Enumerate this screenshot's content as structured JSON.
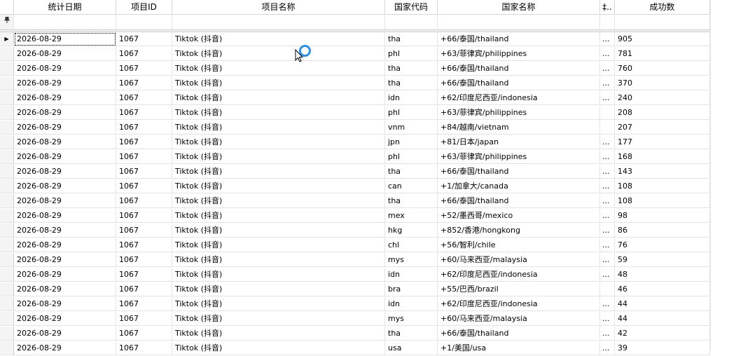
{
  "columns": {
    "date": "统计日期",
    "id": "项目ID",
    "name": "项目名称",
    "code": "国家代码",
    "country": "国家名称",
    "op": "‡..",
    "count": "成功数"
  },
  "filter_icon": "pin-icon",
  "current_row_icon": "row-pointer-icon",
  "rows": [
    {
      "date": "2026-08-29",
      "id": "1067",
      "name": "Tiktok (抖音)",
      "code": "tha",
      "country": "+66/泰国/thailand",
      "op": "...",
      "count": "905"
    },
    {
      "date": "2026-08-29",
      "id": "1067",
      "name": "Tiktok (抖音)",
      "code": "phl",
      "country": "+63/菲律宾/philippines",
      "op": "...",
      "count": "781"
    },
    {
      "date": "2026-08-29",
      "id": "1067",
      "name": "Tiktok (抖音)",
      "code": "tha",
      "country": "+66/泰国/thailand",
      "op": "...",
      "count": "760"
    },
    {
      "date": "2026-08-29",
      "id": "1067",
      "name": "Tiktok (抖音)",
      "code": "tha",
      "country": "+66/泰国/thailand",
      "op": "...",
      "count": "370"
    },
    {
      "date": "2026-08-29",
      "id": "1067",
      "name": "Tiktok (抖音)",
      "code": "idn",
      "country": "+62/印度尼西亚/indonesia",
      "op": "...",
      "count": "240"
    },
    {
      "date": "2026-08-29",
      "id": "1067",
      "name": "Tiktok (抖音)",
      "code": "phl",
      "country": "+63/菲律宾/philippines",
      "op": "",
      "count": "208"
    },
    {
      "date": "2026-08-29",
      "id": "1067",
      "name": "Tiktok (抖音)",
      "code": "vnm",
      "country": "+84/越南/vietnam",
      "op": "",
      "count": "207"
    },
    {
      "date": "2026-08-29",
      "id": "1067",
      "name": "Tiktok (抖音)",
      "code": "jpn",
      "country": "+81/日本/japan",
      "op": "...",
      "count": "177"
    },
    {
      "date": "2026-08-29",
      "id": "1067",
      "name": "Tiktok (抖音)",
      "code": "phl",
      "country": "+63/菲律宾/philippines",
      "op": "...",
      "count": "168"
    },
    {
      "date": "2026-08-29",
      "id": "1067",
      "name": "Tiktok (抖音)",
      "code": "tha",
      "country": "+66/泰国/thailand",
      "op": "...",
      "count": "143"
    },
    {
      "date": "2026-08-29",
      "id": "1067",
      "name": "Tiktok (抖音)",
      "code": "can",
      "country": "+1/加拿大/canada",
      "op": "...",
      "count": "108"
    },
    {
      "date": "2026-08-29",
      "id": "1067",
      "name": "Tiktok (抖音)",
      "code": "tha",
      "country": "+66/泰国/thailand",
      "op": "...",
      "count": "108"
    },
    {
      "date": "2026-08-29",
      "id": "1067",
      "name": "Tiktok (抖音)",
      "code": "mex",
      "country": "+52/墨西哥/mexico",
      "op": "...",
      "count": "98"
    },
    {
      "date": "2026-08-29",
      "id": "1067",
      "name": "Tiktok (抖音)",
      "code": "hkg",
      "country": "+852/香港/hongkong",
      "op": "...",
      "count": "86"
    },
    {
      "date": "2026-08-29",
      "id": "1067",
      "name": "Tiktok (抖音)",
      "code": "chl",
      "country": "+56/智利/chile",
      "op": "...",
      "count": "76"
    },
    {
      "date": "2026-08-29",
      "id": "1067",
      "name": "Tiktok (抖音)",
      "code": "mys",
      "country": "+60/马来西亚/malaysia",
      "op": "...",
      "count": "59"
    },
    {
      "date": "2026-08-29",
      "id": "1067",
      "name": "Tiktok (抖音)",
      "code": "idn",
      "country": "+62/印度尼西亚/indonesia",
      "op": "...",
      "count": "48"
    },
    {
      "date": "2026-08-29",
      "id": "1067",
      "name": "Tiktok (抖音)",
      "code": "bra",
      "country": "+55/巴西/brazil",
      "op": "",
      "count": "46"
    },
    {
      "date": "2026-08-29",
      "id": "1067",
      "name": "Tiktok (抖音)",
      "code": "idn",
      "country": "+62/印度尼西亚/indonesia",
      "op": "...",
      "count": "44"
    },
    {
      "date": "2026-08-29",
      "id": "1067",
      "name": "Tiktok (抖音)",
      "code": "mys",
      "country": "+60/马来西亚/malaysia",
      "op": "...",
      "count": "44"
    },
    {
      "date": "2026-08-29",
      "id": "1067",
      "name": "Tiktok (抖音)",
      "code": "tha",
      "country": "+66/泰国/thailand",
      "op": "...",
      "count": "42"
    },
    {
      "date": "2026-08-29",
      "id": "1067",
      "name": "Tiktok (抖音)",
      "code": "usa",
      "country": "+1/美国/usa",
      "op": "...",
      "count": "39"
    }
  ],
  "colors": {
    "accent": "#2e8fe0",
    "grid_line": "#e3e3e3",
    "header_line": "#d8d8d8"
  }
}
